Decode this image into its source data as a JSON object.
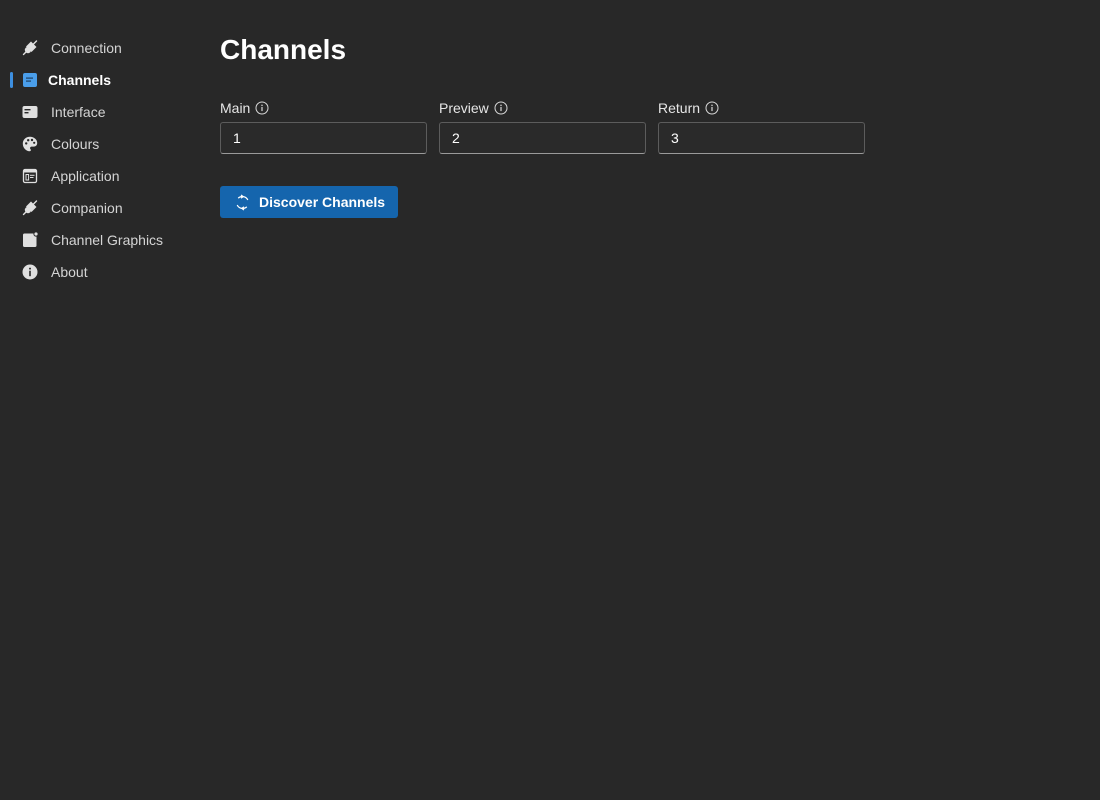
{
  "sidebar": {
    "items": [
      {
        "label": "Connection",
        "icon": "plug-icon",
        "active": false
      },
      {
        "label": "Channels",
        "icon": "channels-icon",
        "active": true
      },
      {
        "label": "Interface",
        "icon": "interface-icon",
        "active": false
      },
      {
        "label": "Colours",
        "icon": "palette-icon",
        "active": false
      },
      {
        "label": "Application",
        "icon": "application-icon",
        "active": false
      },
      {
        "label": "Companion",
        "icon": "plug-icon",
        "active": false
      },
      {
        "label": "Channel Graphics",
        "icon": "graphics-icon",
        "active": false
      },
      {
        "label": "About",
        "icon": "info-icon",
        "active": false
      }
    ]
  },
  "main": {
    "title": "Channels",
    "fields": [
      {
        "label": "Main",
        "value": "1"
      },
      {
        "label": "Preview",
        "value": "2"
      },
      {
        "label": "Return",
        "value": "3"
      }
    ],
    "discover_button": {
      "label": "Discover Channels",
      "icon": "refresh-icon"
    }
  },
  "colors": {
    "background": "#282828",
    "accent": "#1565ad",
    "active_indicator": "#3d8fe0",
    "text": "#e6e6e6"
  }
}
